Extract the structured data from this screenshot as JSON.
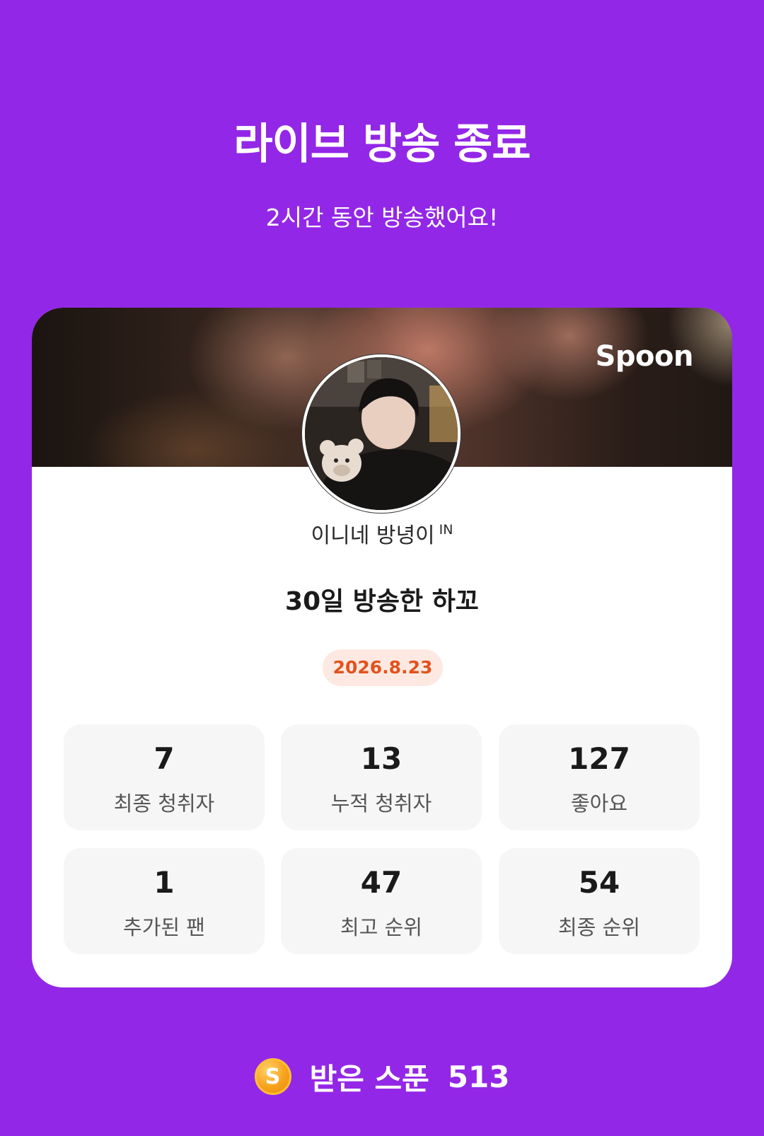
{
  "header": {
    "title": "라이브 방송 종료",
    "subtitle": "2시간 동안 방송했어요!"
  },
  "card": {
    "brand": "Spoon",
    "dj_name": "이니네 방녕이",
    "dj_badge": "IN",
    "headline": "30일 방송한 하꼬",
    "date": "2026.8.23",
    "stats": [
      {
        "value": "7",
        "label": "최종 청취자"
      },
      {
        "value": "13",
        "label": "누적 청취자"
      },
      {
        "value": "127",
        "label": "좋아요"
      },
      {
        "value": "1",
        "label": "추가된 팬"
      },
      {
        "value": "47",
        "label": "최고 순위"
      },
      {
        "value": "54",
        "label": "최종 순위"
      }
    ]
  },
  "footer": {
    "coin_icon": "spoon-coin-icon",
    "coin_glyph": "S",
    "label": "받은 스푼",
    "value": "513"
  },
  "colors": {
    "background": "#9327e7",
    "date_text": "#e2531d",
    "date_bg": "#fde9e2"
  }
}
